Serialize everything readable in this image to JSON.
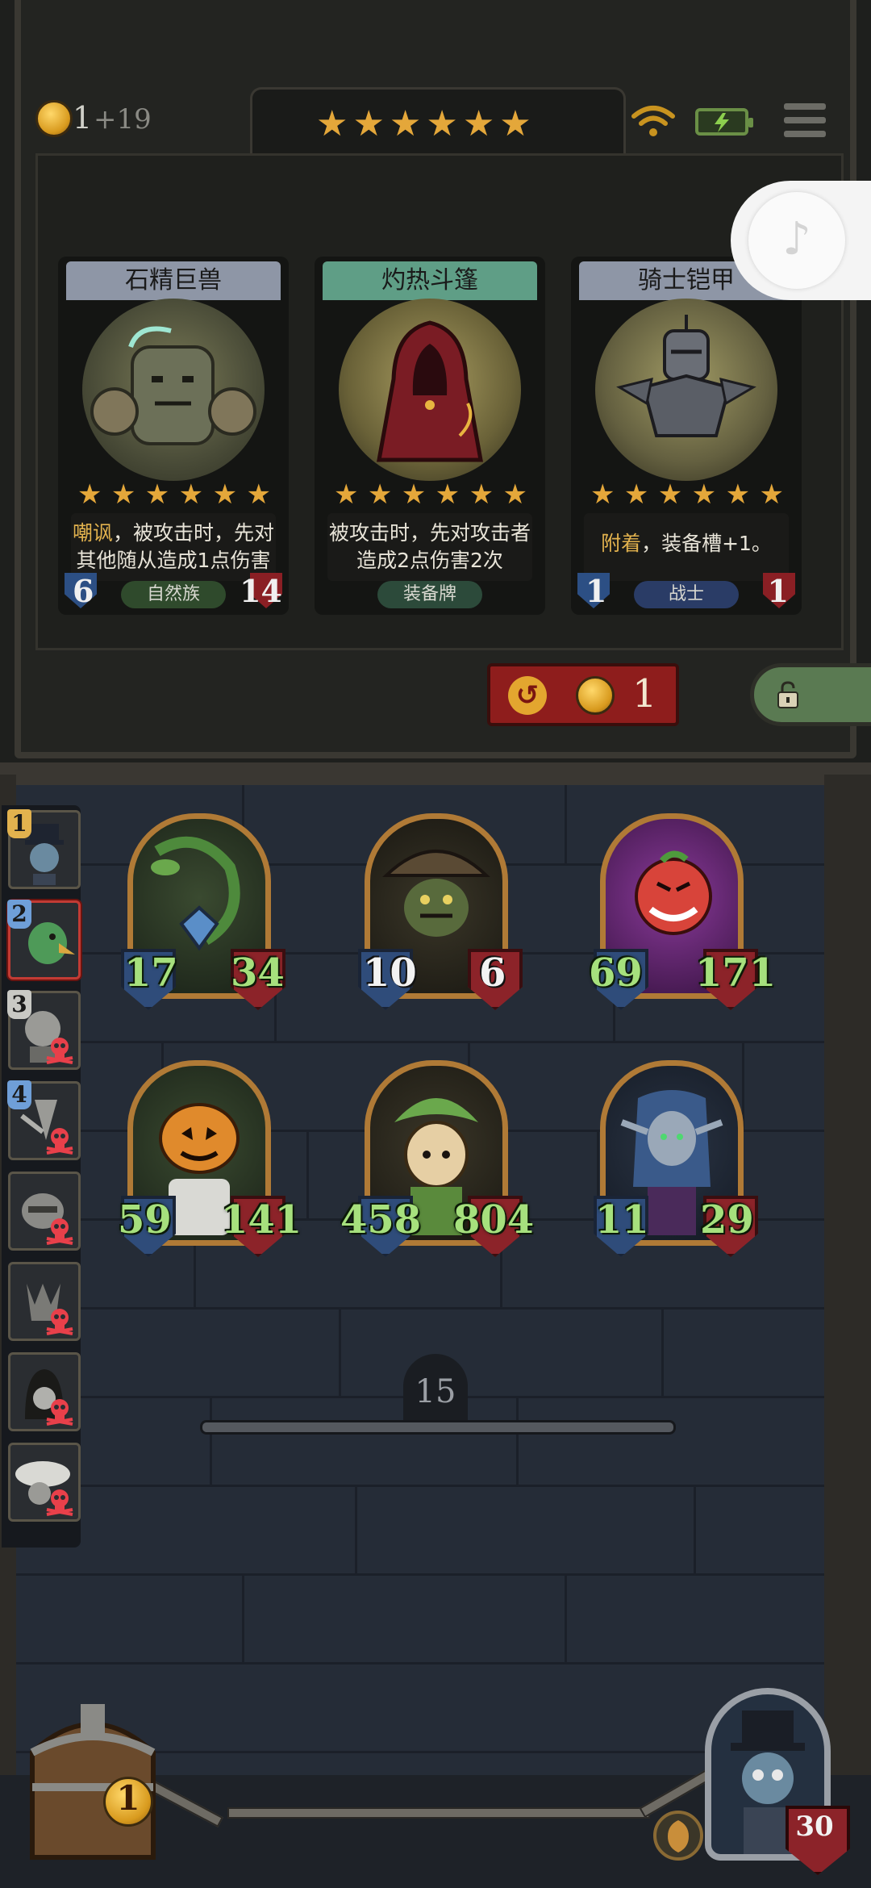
{
  "header": {
    "gold": "1",
    "gold_income": "+19",
    "tavern_stars": 6
  },
  "shop": {
    "cards": [
      {
        "name": "石精巨兽",
        "description_keyword": "嘲讽",
        "description_rest": "，被攻击时，先对其他随从造成1点伤害",
        "stars": 6,
        "attack": "6",
        "health": "14",
        "tribe": "自然族",
        "header_color": "#8e96a6",
        "tag_color": "#2f4a2c"
      },
      {
        "name": "灼热斗篷",
        "description_keyword": "",
        "description_rest": "被攻击时，先对攻击者造成2点伤害2次",
        "stars": 6,
        "attack": "",
        "health": "",
        "tribe": "装备牌",
        "header_color": "#5f9e86",
        "tag_color": "#2c4a3a"
      },
      {
        "name": "骑士铠甲",
        "description_keyword": "附着",
        "description_rest": "，装备槽+1。",
        "stars": 6,
        "attack": "1",
        "health": "1",
        "tribe": "战士",
        "header_color": "#8e96a6",
        "tag_color": "#2a3c66"
      }
    ],
    "refresh_cost": "1"
  },
  "roster": [
    {
      "rank": "1",
      "active": false,
      "dead": false
    },
    {
      "rank": "2",
      "active": true,
      "dead": false
    },
    {
      "rank": "3",
      "active": false,
      "dead": true
    },
    {
      "rank": "4",
      "active": false,
      "dead": true
    },
    {
      "rank": "",
      "active": false,
      "dead": true
    },
    {
      "rank": "",
      "active": false,
      "dead": true
    },
    {
      "rank": "",
      "active": false,
      "dead": true
    },
    {
      "rank": "",
      "active": false,
      "dead": true
    }
  ],
  "board": {
    "minions": [
      {
        "attack": "17",
        "health": "34",
        "portrait": "vine-golem"
      },
      {
        "attack": "10",
        "health": "6",
        "portrait": "goblin-witch"
      },
      {
        "attack": "69",
        "health": "171",
        "portrait": "tomato-demon"
      },
      {
        "attack": "59",
        "health": "141",
        "portrait": "pumpkin-head"
      },
      {
        "attack": "458",
        "health": "804",
        "portrait": "leaf-sprout"
      },
      {
        "attack": "11",
        "health": "29",
        "portrait": "elf-sorceress"
      }
    ]
  },
  "timer": "15",
  "bottom": {
    "chest_count": "1",
    "hero_health": "30"
  }
}
